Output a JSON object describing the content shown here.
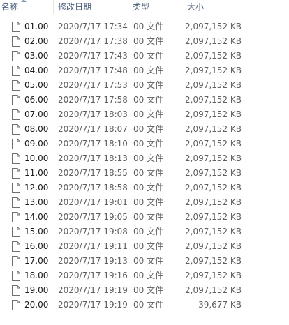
{
  "header": {
    "name": "名称",
    "date": "修改日期",
    "type": "类型",
    "size": "大小"
  },
  "files": [
    {
      "name": "01.00",
      "date": "2020/7/17 17:34",
      "type": "00 文件",
      "size": "2,097,152 KB"
    },
    {
      "name": "02.00",
      "date": "2020/7/17 17:38",
      "type": "00 文件",
      "size": "2,097,152 KB"
    },
    {
      "name": "03.00",
      "date": "2020/7/17 17:43",
      "type": "00 文件",
      "size": "2,097,152 KB"
    },
    {
      "name": "04.00",
      "date": "2020/7/17 17:48",
      "type": "00 文件",
      "size": "2,097,152 KB"
    },
    {
      "name": "05.00",
      "date": "2020/7/17 17:53",
      "type": "00 文件",
      "size": "2,097,152 KB"
    },
    {
      "name": "06.00",
      "date": "2020/7/17 17:58",
      "type": "00 文件",
      "size": "2,097,152 KB"
    },
    {
      "name": "07.00",
      "date": "2020/7/17 18:03",
      "type": "00 文件",
      "size": "2,097,152 KB"
    },
    {
      "name": "08.00",
      "date": "2020/7/17 18:07",
      "type": "00 文件",
      "size": "2,097,152 KB"
    },
    {
      "name": "09.00",
      "date": "2020/7/17 18:10",
      "type": "00 文件",
      "size": "2,097,152 KB"
    },
    {
      "name": "10.00",
      "date": "2020/7/17 18:13",
      "type": "00 文件",
      "size": "2,097,152 KB"
    },
    {
      "name": "11.00",
      "date": "2020/7/17 18:55",
      "type": "00 文件",
      "size": "2,097,152 KB"
    },
    {
      "name": "12.00",
      "date": "2020/7/17 18:58",
      "type": "00 文件",
      "size": "2,097,152 KB"
    },
    {
      "name": "13.00",
      "date": "2020/7/17 19:01",
      "type": "00 文件",
      "size": "2,097,152 KB"
    },
    {
      "name": "14.00",
      "date": "2020/7/17 19:05",
      "type": "00 文件",
      "size": "2,097,152 KB"
    },
    {
      "name": "15.00",
      "date": "2020/7/17 19:08",
      "type": "00 文件",
      "size": "2,097,152 KB"
    },
    {
      "name": "16.00",
      "date": "2020/7/17 19:11",
      "type": "00 文件",
      "size": "2,097,152 KB"
    },
    {
      "name": "17.00",
      "date": "2020/7/17 19:13",
      "type": "00 文件",
      "size": "2,097,152 KB"
    },
    {
      "name": "18.00",
      "date": "2020/7/17 19:16",
      "type": "00 文件",
      "size": "2,097,152 KB"
    },
    {
      "name": "19.00",
      "date": "2020/7/17 19:19",
      "type": "00 文件",
      "size": "2,097,152 KB"
    },
    {
      "name": "20.00",
      "date": "2020/7/17 19:19",
      "type": "00 文件",
      "size": "39,677 KB"
    }
  ],
  "icons": {
    "file": "file-icon",
    "sort": "sort-ascending-icon"
  }
}
